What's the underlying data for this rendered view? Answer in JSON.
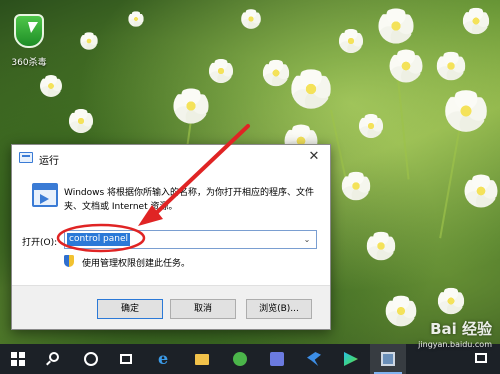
{
  "desktop": {
    "icons": [
      {
        "label": "360杀毒",
        "icon": "360-antivirus-shield-icon"
      }
    ]
  },
  "run_dialog": {
    "title": "运行",
    "close_glyph": "✕",
    "description": "Windows 将根据你所输入的名称，为你打开相应的程序、文件夹、文档或 Internet 资源。",
    "open_label": "打开(O):",
    "input_value": "control panel",
    "admin_note": "使用管理权限创建此任务。",
    "buttons": {
      "ok": "确定",
      "cancel": "取消",
      "browse": "浏览(B)..."
    }
  },
  "annotation": {
    "color": "#e02424"
  },
  "taskbar": {
    "items": [
      "start-icon",
      "search-icon",
      "cortana-icon",
      "task-view-icon",
      "edge-icon",
      "file-explorer-icon",
      "360-security-icon",
      "calculator-icon",
      "bird-app-icon",
      "media-player-icon",
      "active-window-icon"
    ]
  },
  "watermark": {
    "logo": "Bai 经验",
    "url": "jingyan.baidu.com"
  }
}
